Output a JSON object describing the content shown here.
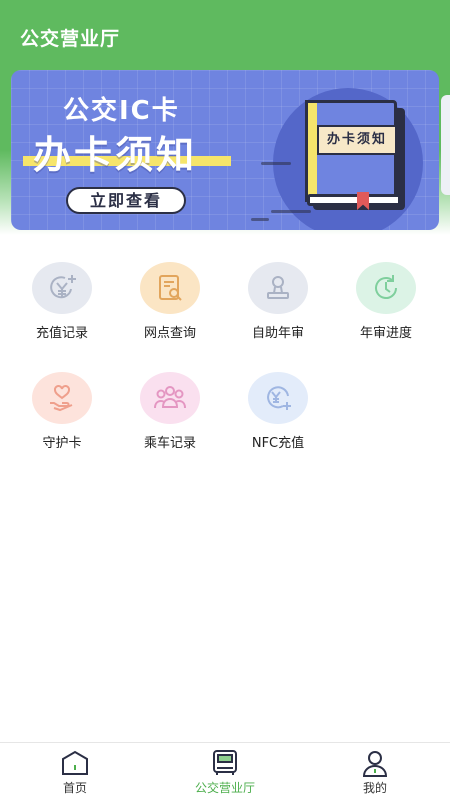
{
  "header": {
    "title": "公交营业厅"
  },
  "banner": {
    "sub_title": "公交IC卡",
    "main_title": "办卡须知",
    "cta_label": "立即查看",
    "book_label": "办卡须知"
  },
  "services": [
    {
      "label": "充值记录",
      "icon": "yen-plus-icon",
      "bg": "#e6e9f0",
      "color": "#aab2c4"
    },
    {
      "label": "网点查询",
      "icon": "document-search-icon",
      "bg": "#fbe5c4",
      "color": "#e2a55c"
    },
    {
      "label": "自助年审",
      "icon": "stamp-icon",
      "bg": "#e6e9f0",
      "color": "#aab2c4"
    },
    {
      "label": "年审进度",
      "icon": "clock-refresh-icon",
      "bg": "#dcf3e6",
      "color": "#7fcf9d"
    },
    {
      "label": "守护卡",
      "icon": "hand-heart-icon",
      "bg": "#fde3dc",
      "color": "#ef9f8c"
    },
    {
      "label": "乘车记录",
      "icon": "group-people-icon",
      "bg": "#fae0ef",
      "color": "#e496c2"
    },
    {
      "label": "NFC充值",
      "icon": "coin-yen-icon",
      "bg": "#e3ecfa",
      "color": "#9fb6e2"
    }
  ],
  "tabbar": {
    "items": [
      {
        "label": "首页",
        "icon": "home-icon",
        "active": false
      },
      {
        "label": "公交营业厅",
        "icon": "bus-icon",
        "active": true
      },
      {
        "label": "我的",
        "icon": "user-icon",
        "active": false
      }
    ]
  },
  "colors": {
    "primary_green": "#5fba5f",
    "active_tab": "#4cae4c",
    "banner_blue": "#6f84e0"
  }
}
